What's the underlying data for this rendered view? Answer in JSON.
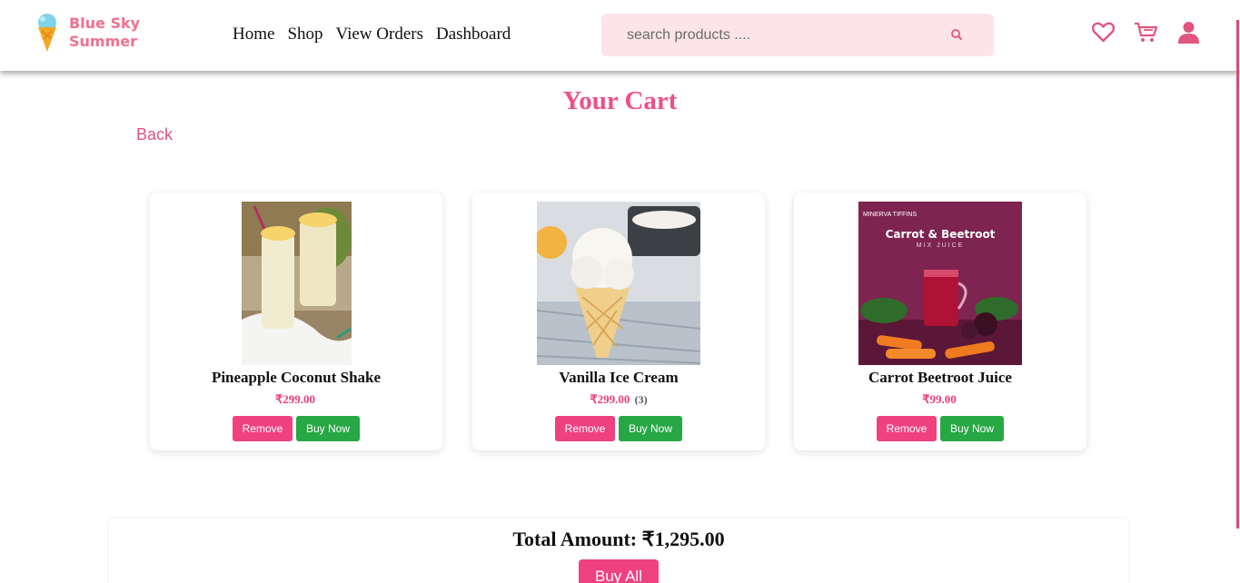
{
  "brand": {
    "line1": "Blue Sky",
    "line2": "Summer"
  },
  "nav": [
    "Home",
    "Shop",
    "View Orders",
    "Dashboard"
  ],
  "search": {
    "placeholder": "search products ...."
  },
  "header_icons": [
    "heart-icon",
    "cart-icon",
    "user-icon"
  ],
  "colors": {
    "accent": "#f04f8a",
    "remove": "#f0417f",
    "buy": "#28a745",
    "search_bg": "#fde4e8"
  },
  "page": {
    "title": "Your Cart",
    "back_label": "Back"
  },
  "cart": [
    {
      "name": "Pineapple Coconut Shake",
      "price": "₹299.00",
      "qty": "",
      "remove_label": "Remove",
      "buy_label": "Buy Now"
    },
    {
      "name": "Vanilla Ice Cream",
      "price": "₹299.00",
      "qty": "(3)",
      "remove_label": "Remove",
      "buy_label": "Buy Now"
    },
    {
      "name": "Carrot Beetroot Juice",
      "price": "₹99.00",
      "qty": "",
      "remove_label": "Remove",
      "buy_label": "Buy Now",
      "image_text": {
        "brand": "MINERVA TIFFINS",
        "title": "Carrot & Beetroot",
        "subtitle": "MIX JUICE"
      }
    }
  ],
  "summary": {
    "total_text": "Total Amount: ₹1,295.00",
    "buy_all_label": "Buy All"
  }
}
